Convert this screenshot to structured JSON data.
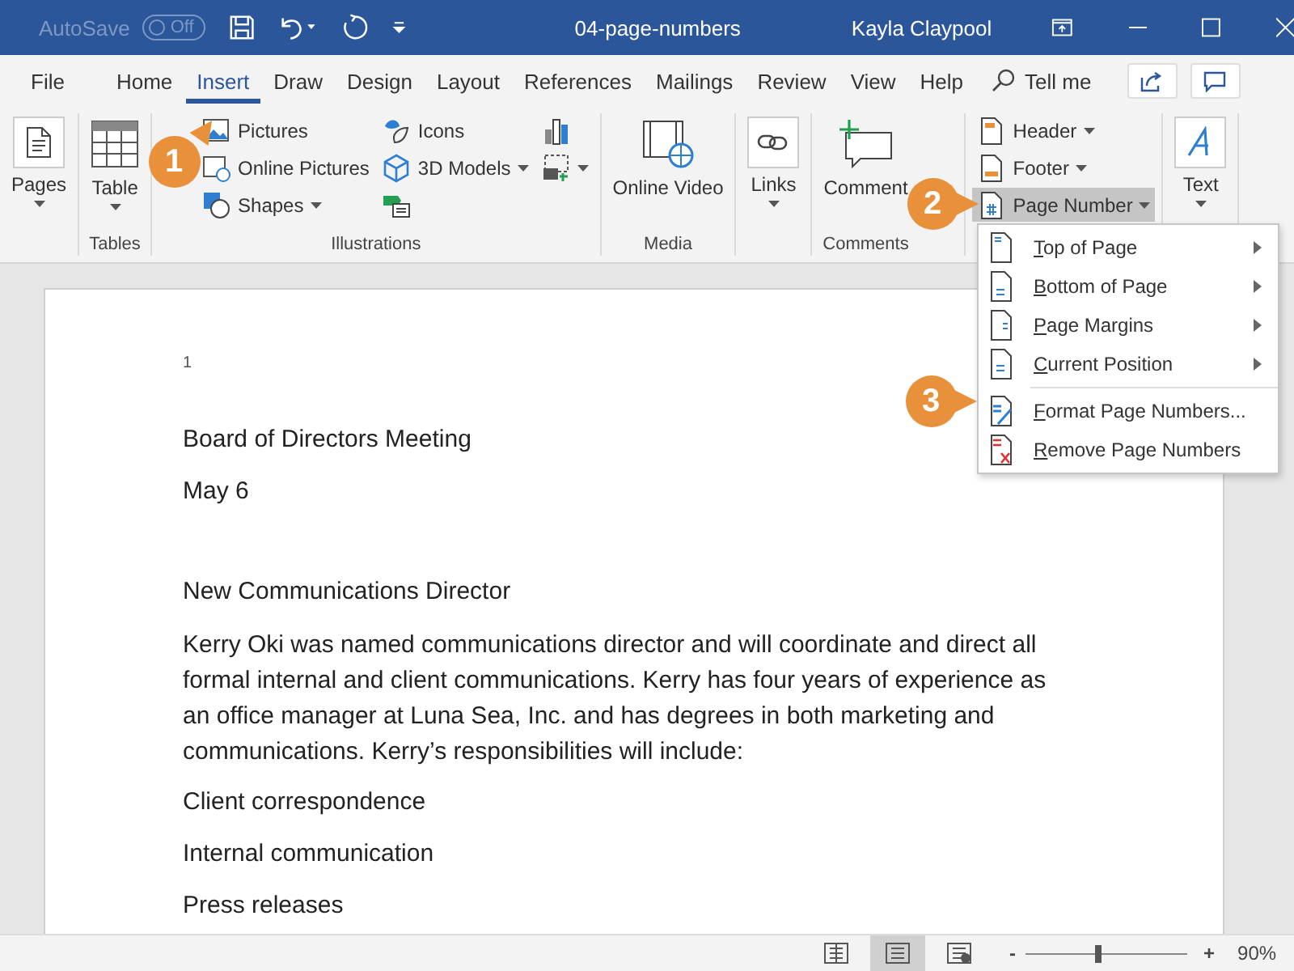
{
  "title_bar": {
    "autosave_label": "AutoSave",
    "autosave_toggle": {
      "label": "Off",
      "on": false
    },
    "document_title": "04-page-numbers",
    "user": "Kayla Claypool"
  },
  "menu_tabs": [
    {
      "label": "File",
      "selected": false
    },
    {
      "label": "Home",
      "selected": false
    },
    {
      "label": "Insert",
      "selected": true
    },
    {
      "label": "Draw",
      "selected": false
    },
    {
      "label": "Design",
      "selected": false
    },
    {
      "label": "Layout",
      "selected": false
    },
    {
      "label": "References",
      "selected": false
    },
    {
      "label": "Mailings",
      "selected": false
    },
    {
      "label": "Review",
      "selected": false
    },
    {
      "label": "View",
      "selected": false
    },
    {
      "label": "Help",
      "selected": false
    }
  ],
  "tell_me": "Tell me",
  "ribbon_groups": [
    {
      "items": [
        {
          "kind": "large",
          "label": "Pages",
          "caret": true
        }
      ]
    },
    {
      "label": "Tables",
      "items": [
        {
          "kind": "large",
          "label": "Table",
          "caret": true
        }
      ]
    },
    {
      "label": "Illustrations",
      "columns": [
        [
          {
            "kind": "small",
            "label": "Pictures",
            "caret": false
          },
          {
            "kind": "small",
            "label": "Online Pictures",
            "caret": false
          },
          {
            "kind": "small",
            "label": "Shapes",
            "caret": true
          }
        ],
        [
          {
            "kind": "small",
            "label": "Icons",
            "caret": false
          },
          {
            "kind": "small",
            "label": "3D Models",
            "caret": true
          },
          {
            "kind": "icon",
            "caret": false
          }
        ],
        [
          {
            "kind": "icon",
            "caret": false
          },
          {
            "kind": "icon",
            "caret": true
          }
        ]
      ]
    },
    {
      "label": "Media",
      "items": [
        {
          "kind": "large",
          "label": "Online Video",
          "caret": false
        }
      ]
    },
    {
      "items": [
        {
          "kind": "large",
          "label": "Links",
          "caret": true
        }
      ]
    },
    {
      "label": "Comments",
      "items": [
        {
          "kind": "large",
          "label": "Comment",
          "caret": false
        }
      ]
    },
    {
      "columns": [
        [
          {
            "kind": "small",
            "label": "Header",
            "caret": true
          },
          {
            "kind": "small",
            "label": "Footer",
            "caret": true
          },
          {
            "kind": "small",
            "label": "Page Number",
            "caret": true,
            "selected": true
          }
        ]
      ]
    },
    {
      "items": [
        {
          "kind": "large",
          "label": "Text",
          "caret": true
        }
      ]
    }
  ],
  "document": {
    "page_number": "1",
    "lines": [
      {
        "kind": "line",
        "text": "Board of Directors Meeting"
      },
      {
        "kind": "line",
        "text": "May 6"
      },
      {
        "kind": "blank"
      },
      {
        "kind": "line",
        "text": "New Communications Director"
      },
      {
        "kind": "paragraph",
        "text": "Kerry Oki was named communications director and will coordinate and direct all formal internal and client communications. Kerry has four years of experience as an office manager at Luna Sea, Inc. and has degrees in both marketing and communications. Kerry’s responsibilities will include:"
      },
      {
        "kind": "line",
        "text": "Client correspondence"
      },
      {
        "kind": "line",
        "text": "Internal communication"
      },
      {
        "kind": "line",
        "text": "Press releases"
      }
    ]
  },
  "page_number_menu": [
    {
      "kind": "submenu",
      "label": "Top of Page"
    },
    {
      "kind": "submenu",
      "label": "Bottom of Page"
    },
    {
      "kind": "submenu",
      "label": "Page Margins"
    },
    {
      "kind": "submenu",
      "label": "Current Position"
    },
    {
      "kind": "separator"
    },
    {
      "kind": "command",
      "label": "Format Page Numbers..."
    },
    {
      "kind": "command",
      "label": "Remove Page Numbers"
    }
  ],
  "callouts": [
    "1",
    "2",
    "3"
  ],
  "status_bar": {
    "views": [
      {
        "selected": false
      },
      {
        "selected": true
      },
      {
        "selected": false
      }
    ],
    "zoom_out": "-",
    "zoom_in": "+",
    "zoom_slider": {
      "level": 0.45
    },
    "zoom": "90%"
  }
}
